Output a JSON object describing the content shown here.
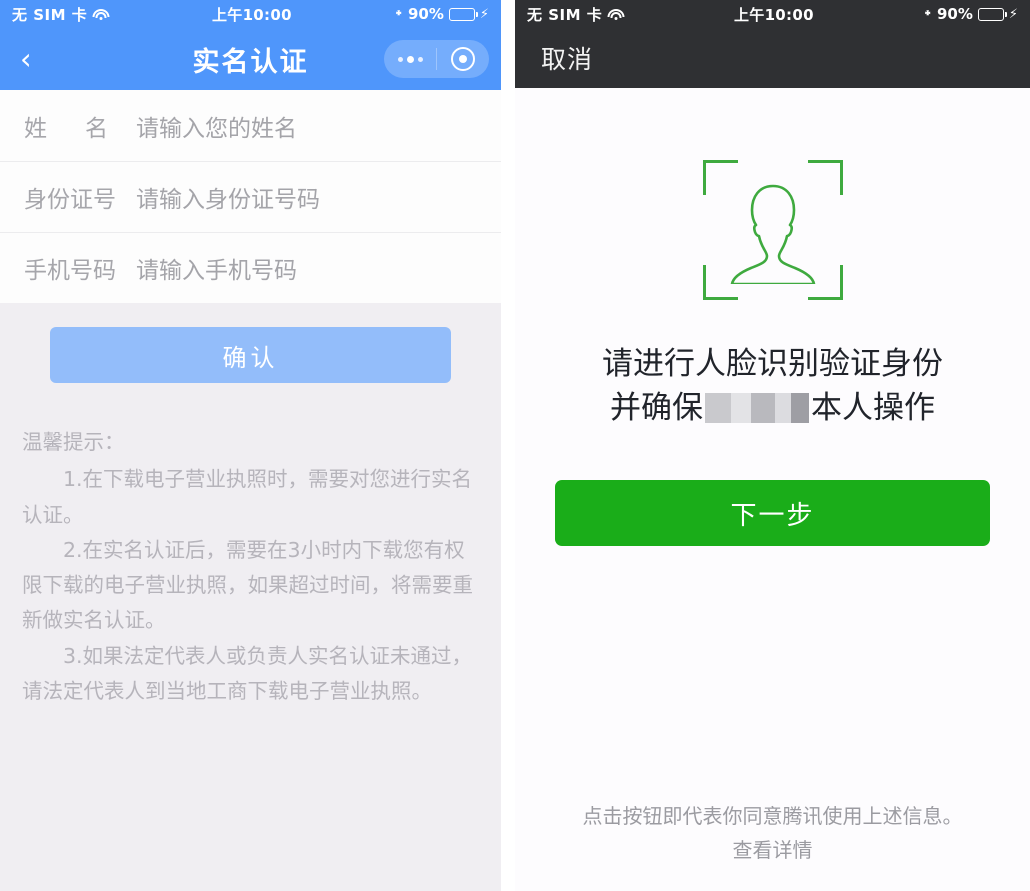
{
  "left_screen": {
    "status_bar": {
      "carrier": "无 SIM 卡",
      "wifi_icon": "wifi-icon",
      "time": "上午10:00",
      "bluetooth_icon": "bluetooth-icon",
      "battery_percent": "90%",
      "charging_icon": "lightning-bolt-icon",
      "battery_level": 90
    },
    "navbar": {
      "back_icon": "chevron-left-icon",
      "title": "实名认证",
      "more_icon": "more-dots-icon",
      "target_icon": "target-circle-icon"
    },
    "form": {
      "rows": [
        {
          "label_a": "姓",
          "label_b": "名",
          "label": "姓  名",
          "placeholder": "请输入您的姓名"
        },
        {
          "label": "身份证号",
          "placeholder": "请输入身份证号码"
        },
        {
          "label": "手机号码",
          "placeholder": "请输入手机号码"
        }
      ]
    },
    "confirm_button": "确认",
    "tips": {
      "title": "温馨提示：",
      "items": [
        "1.在下载电子营业执照时，需要对您进行实名认证。",
        "2.在实名认证后，需要在3小时内下载您有权限下载的电子营业执照，如果超过时间，将需要重新做实名认证。",
        "3.如果法定代表人或负责人实名认证未通过，请法定代表人到当地工商下载电子营业执照。"
      ]
    },
    "colors": {
      "header_blue": "#4f96fb",
      "confirm_blue": "#93bdfa",
      "page_gray": "#f0eef2"
    }
  },
  "right_screen": {
    "status_bar": {
      "carrier": "无 SIM 卡",
      "wifi_icon": "wifi-icon",
      "time": "上午10:00",
      "bluetooth_icon": "bluetooth-icon",
      "battery_percent": "90%",
      "charging_icon": "lightning-bolt-icon",
      "battery_level": 90
    },
    "cancel_button": "取消",
    "face_icon": "face-scan-icon",
    "instruction": {
      "line1": "请进行人脸识别验证身份",
      "line2_prefix": "并确保",
      "line2_redacted": "mosaic-redaction",
      "line2_suffix": "本人操作"
    },
    "next_button": "下一步",
    "footer": {
      "agreement": "点击按钮即代表你同意腾讯使用上述信息。",
      "detail_link": "查看详情"
    },
    "colors": {
      "status_dark": "#2f3033",
      "wechat_green": "#1aad19",
      "icon_green": "#3faa3f"
    }
  }
}
